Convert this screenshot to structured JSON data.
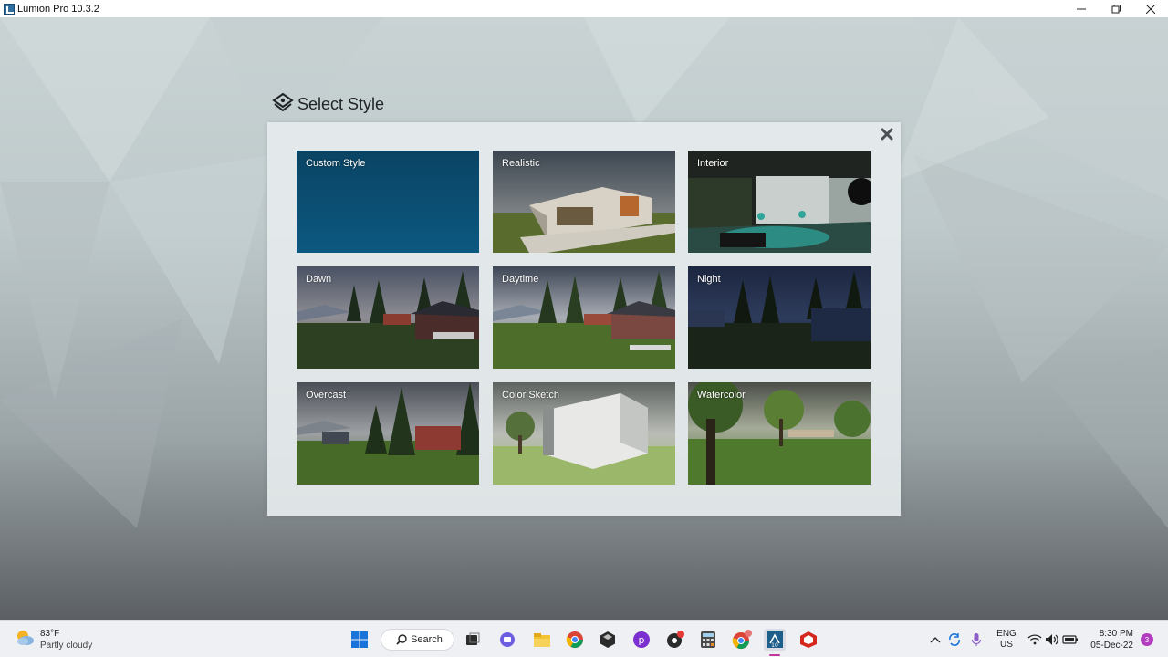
{
  "window": {
    "title": "Lumion Pro 10.3.2",
    "controls": [
      "minimize-icon",
      "maximize-icon",
      "close-icon"
    ]
  },
  "heading": {
    "icon": "layers-icon",
    "label": "Select Style"
  },
  "dialog": {
    "close_icon": "close-icon",
    "styles": [
      {
        "label": "Custom Style"
      },
      {
        "label": "Realistic"
      },
      {
        "label": "Interior"
      },
      {
        "label": "Dawn"
      },
      {
        "label": "Daytime"
      },
      {
        "label": "Night"
      },
      {
        "label": "Overcast"
      },
      {
        "label": "Color Sketch"
      },
      {
        "label": "Watercolor"
      }
    ]
  },
  "taskbar": {
    "weather": {
      "temp": "83°F",
      "condition": "Partly cloudy",
      "icon": "partly-cloudy-icon"
    },
    "search_label": "Search",
    "apps": [
      "windows-start-icon",
      "search-icon",
      "task-view-icon",
      "teams-chat-icon",
      "file-explorer-icon",
      "chrome-icon",
      "unity-icon",
      "app-purple-icon",
      "recorder-app-icon",
      "calculator-icon",
      "chrome-profile-icon",
      "lumion-icon",
      "sketchup-icon"
    ],
    "tray": {
      "language": "ENG",
      "region": "US",
      "time": "8:30 PM",
      "date": "05-Dec-22",
      "notifications": "3"
    }
  },
  "colors": {
    "accent": "#0b4d72",
    "notification_badge": "#b23dbf"
  }
}
